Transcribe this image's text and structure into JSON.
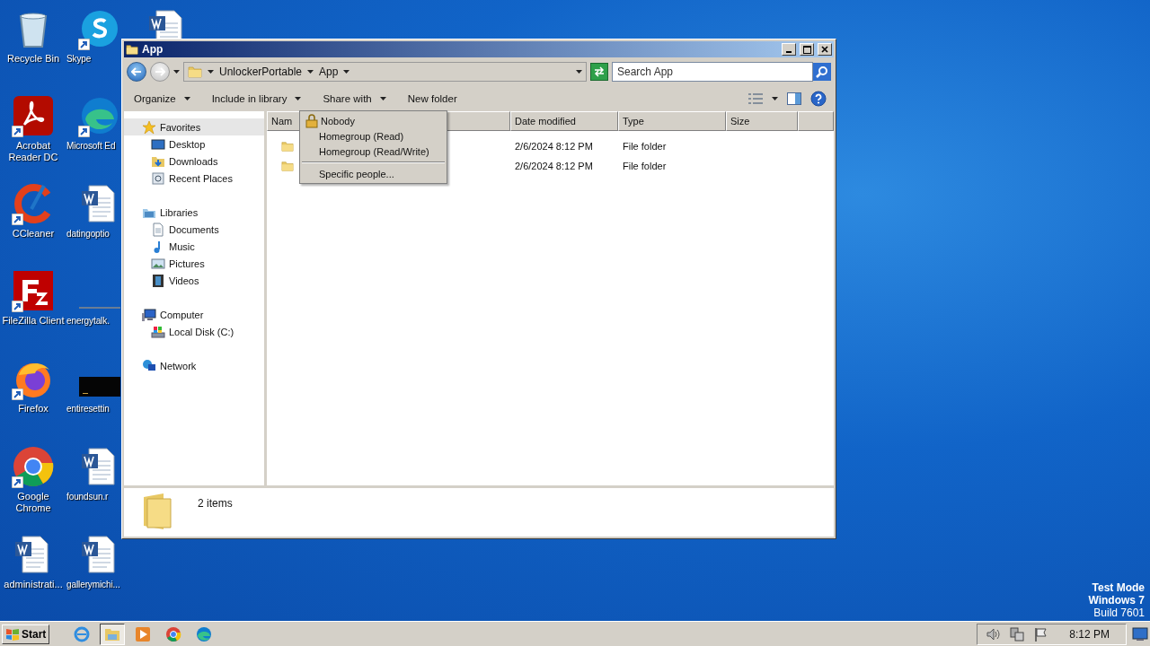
{
  "desktop_columns": [
    [
      {
        "label": "Recycle Bin",
        "kind": "recycle",
        "shortcut": false
      },
      {
        "label": "Acrobat Reader DC",
        "kind": "acrobat",
        "shortcut": true
      },
      {
        "label": "CCleaner",
        "kind": "ccleaner",
        "shortcut": true
      },
      {
        "label": "FileZilla Client",
        "kind": "filezilla",
        "shortcut": true
      },
      {
        "label": "Firefox",
        "kind": "firefox",
        "shortcut": true
      },
      {
        "label": "Google Chrome",
        "kind": "chrome",
        "shortcut": true
      },
      {
        "label": "administrati...",
        "kind": "word",
        "shortcut": false
      }
    ],
    [
      {
        "label": "Skype",
        "kind": "skype",
        "shortcut": true
      },
      {
        "label": "Microsoft Ed",
        "kind": "edge",
        "shortcut": true
      },
      {
        "label": "datingoptio",
        "kind": "word",
        "shortcut": false
      },
      {
        "label": "energytalk.",
        "kind": "thumb",
        "shortcut": false
      },
      {
        "label": "entiresettin",
        "kind": "black",
        "shortcut": false
      },
      {
        "label": "foundsun.r",
        "kind": "word",
        "shortcut": false
      },
      {
        "label": "gallerymichi...",
        "kind": "word",
        "shortcut": false
      }
    ],
    [
      {
        "kind": "word"
      }
    ]
  ],
  "window": {
    "title": "App",
    "breadcrumb": [
      "UnlockerPortable",
      "App"
    ],
    "search": {
      "placeholder": "Search App"
    },
    "toolbar": [
      {
        "label": "Organize",
        "dropdown": true
      },
      {
        "label": "Include in library",
        "dropdown": true
      },
      {
        "label": "Share with",
        "dropdown": true
      },
      {
        "label": "New folder",
        "dropdown": false
      }
    ],
    "nav": [
      {
        "label": "Favorites",
        "kind": "star",
        "selected": true,
        "children": [
          {
            "label": "Desktop",
            "kind": "desktop",
            "selected": false
          },
          {
            "label": "Downloads",
            "kind": "downloads",
            "selected": false
          },
          {
            "label": "Recent Places",
            "kind": "recent",
            "selected": false
          }
        ]
      },
      {
        "label": "Libraries",
        "kind": "library",
        "selected": false,
        "children": [
          {
            "label": "Documents",
            "kind": "document",
            "selected": false
          },
          {
            "label": "Music",
            "kind": "music",
            "selected": false
          },
          {
            "label": "Pictures",
            "kind": "picture",
            "selected": false
          },
          {
            "label": "Videos",
            "kind": "video",
            "selected": false
          }
        ]
      },
      {
        "label": "Computer",
        "kind": "computer",
        "selected": false,
        "children": [
          {
            "label": "Local Disk (C:)",
            "kind": "disk",
            "selected": false
          }
        ]
      },
      {
        "label": "Network",
        "kind": "network",
        "selected": false
      }
    ],
    "table": {
      "columns": [
        "Nam",
        "Date modified",
        "Type",
        "Size"
      ],
      "rows": [
        {
          "date_modified": "2/6/2024 8:12 PM",
          "type": "File folder"
        },
        {
          "date_modified": "2/6/2024 8:12 PM",
          "type": "File folder"
        }
      ]
    },
    "share_menu": [
      {
        "label": "Nobody",
        "kind": "lock"
      },
      {
        "label": "Homegroup (Read)",
        "kind": "item"
      },
      {
        "label": "Homegroup (Read/Write)",
        "kind": "item"
      },
      {
        "kind": "separator"
      },
      {
        "label": "Specific people...",
        "kind": "item"
      }
    ],
    "details": {
      "count": "2 items"
    }
  },
  "os_watermark": [
    "Test Mode",
    "Windows 7",
    "Build 7601"
  ],
  "taskbar": {
    "start": "Start",
    "apps": [
      {
        "kind": "ie",
        "selected": false
      },
      {
        "kind": "explorer",
        "selected": true
      },
      {
        "kind": "media",
        "selected": false
      },
      {
        "kind": "chrome",
        "selected": false
      },
      {
        "kind": "edge",
        "selected": false
      }
    ],
    "clock": "8:12 PM"
  }
}
